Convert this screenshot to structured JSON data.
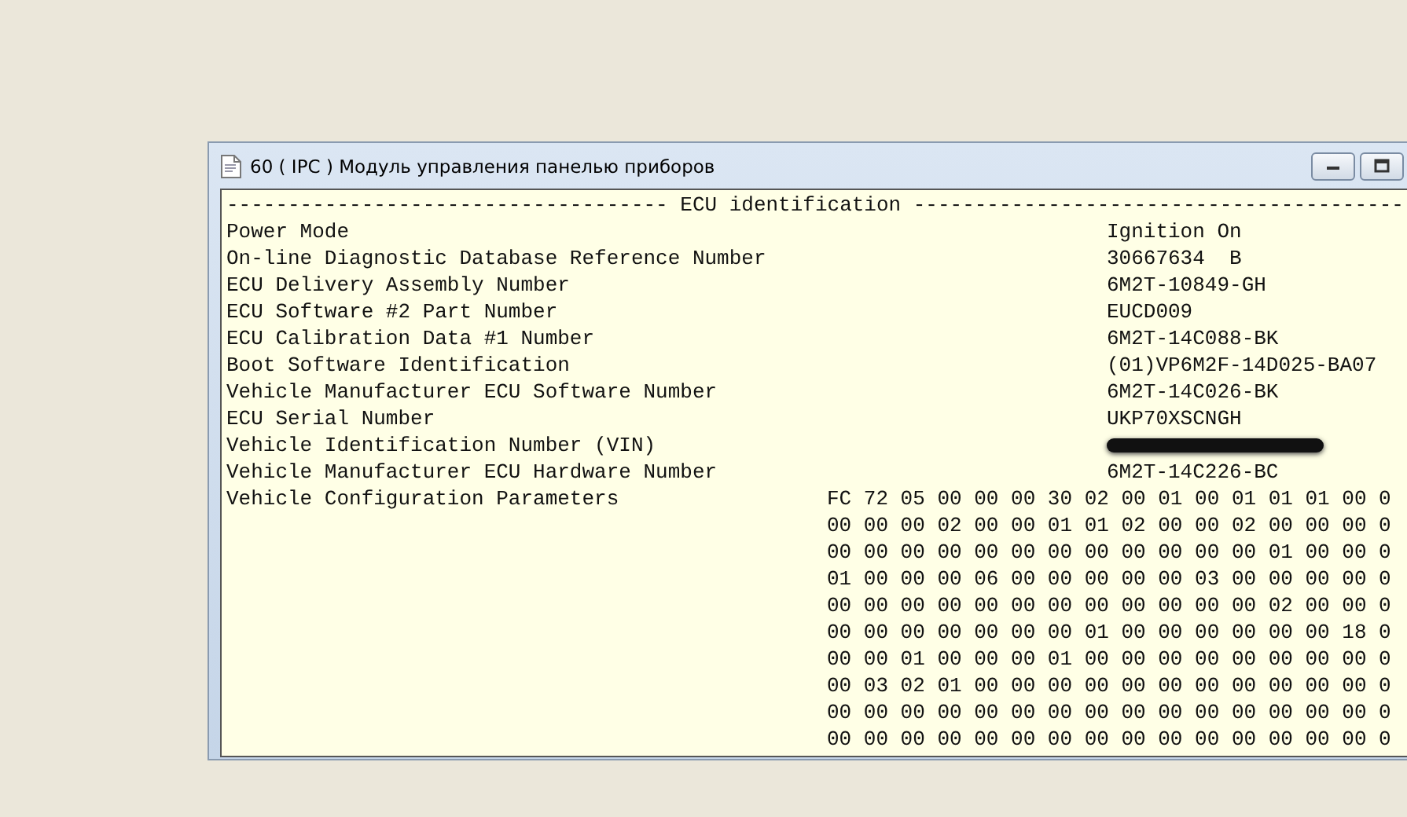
{
  "window": {
    "title": "60 ( IPC ) Модуль управления панелью приборов"
  },
  "section_header": "------------------------------------ ECU identification ----------------------------------------",
  "rows": [
    {
      "label": "Power Mode",
      "value": "Ignition On",
      "kind": "text"
    },
    {
      "label": "On-line Diagnostic Database Reference Number",
      "value": "30667634  B",
      "kind": "text"
    },
    {
      "label": "ECU Delivery Assembly Number",
      "value": "6M2T-10849-GH",
      "kind": "text"
    },
    {
      "label": "ECU Software #2 Part Number",
      "value": "EUCD009",
      "kind": "text"
    },
    {
      "label": "ECU Calibration Data #1 Number",
      "value": "6M2T-14C088-BK",
      "kind": "text"
    },
    {
      "label": "Boot Software Identification",
      "value": "(01)VP6M2F-14D025-BA07",
      "kind": "text"
    },
    {
      "label": "Vehicle Manufacturer ECU Software Number",
      "value": "6M2T-14C026-BK",
      "kind": "text"
    },
    {
      "label": "ECU Serial Number",
      "value": "UKP70XSCNGH",
      "kind": "text"
    },
    {
      "label": "Vehicle Identification Number (VIN)",
      "kind": "redacted"
    },
    {
      "label": "Vehicle Manufacturer ECU Hardware Number",
      "value": "6M2T-14C226-BC",
      "kind": "text"
    },
    {
      "label": "Vehicle Configuration Parameters",
      "kind": "hex",
      "lines": [
        "FC 72 05 00 00 00 30 02 00 01 00 01 01 01 00 0",
        "00 00 00 02 00 00 01 01 02 00 00 02 00 00 00 0",
        "00 00 00 00 00 00 00 00 00 00 00 00 01 00 00 0",
        "01 00 00 00 06 00 00 00 00 00 03 00 00 00 00 0",
        "00 00 00 00 00 00 00 00 00 00 00 00 02 00 00 0",
        "00 00 00 00 00 00 00 01 00 00 00 00 00 00 18 0",
        "00 00 01 00 00 00 01 00 00 00 00 00 00 00 00 0",
        "00 03 02 01 00 00 00 00 00 00 00 00 00 00 00 0",
        "00 00 00 00 00 00 00 00 00 00 00 00 00 00 00 0",
        "00 00 00 00 00 00 00 00 00 00 00 00 00 00 00 0"
      ]
    }
  ]
}
